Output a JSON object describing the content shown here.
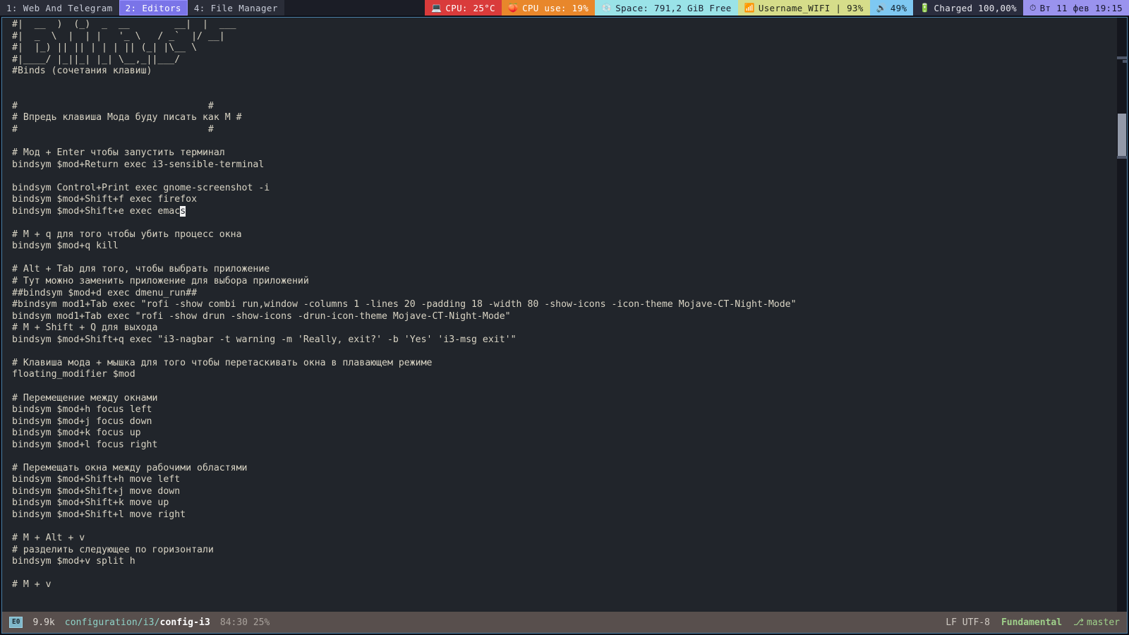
{
  "i3bar": {
    "workspaces": [
      {
        "label": "1: Web And Telegram",
        "focused": false
      },
      {
        "label": "2: Editors",
        "focused": true
      },
      {
        "label": "4: File Manager",
        "focused": false
      }
    ],
    "blocks": [
      {
        "name": "cpu-temp",
        "icon": "laptop-icon",
        "glyph": "💻",
        "text": "CPU: 25°C"
      },
      {
        "name": "cpu-usage",
        "icon": "chip-icon",
        "glyph": "🍑",
        "text": "CPU use: 19%"
      },
      {
        "name": "disk-space",
        "icon": "disk-icon",
        "glyph": "💿",
        "text": "Space: 791,2 GiB Free"
      },
      {
        "name": "wifi",
        "icon": "wifi-icon",
        "glyph": "📶",
        "text": "Username_WIFI | 93%"
      },
      {
        "name": "volume",
        "icon": "speaker-icon",
        "glyph": "🔊",
        "text": "49%"
      },
      {
        "name": "battery",
        "icon": "battery-icon",
        "glyph": "🔋",
        "text": "Charged 100,00%"
      },
      {
        "name": "clock",
        "icon": "clock-icon",
        "glyph": "⏱",
        "text": "Вт 11 фев 19:15"
      }
    ]
  },
  "editor": {
    "code": "#|  __  )  (_)  _  __        __|  |  ___\n#|  _  \\  |  | |   '_ \\   / _`  |/ __|\n#|  |_) || || | | | || (_| |\\__ \\\n#|____/ |_||_| |_| \\__,_||___/\n#Binds (сочетания клавиш)\n\n\n#                                  #\n# Впредь клавиша Мода буду писать как М #\n#                                  #\n\n# Мод + Enter чтобы запустить терминал\nbindsym $mod+Return exec i3-sensible-terminal\n\nbindsym Control+Print exec gnome-screenshot -i\nbindsym $mod+Shift+f exec firefox\nbindsym $mod+Shift+e exec emac§s§\n\n# M + q для того чтобы убить процесс окна\nbindsym $mod+q kill\n\n# Alt + Tab для того, чтобы выбрать приложение\n# Тут можно заменить приложение для выбора приложений\n##bindsym $mod+d exec dmenu_run##\n#bindsym mod1+Tab exec \"rofi -show combi run,window -columns 1 -lines 20 -padding 18 -width 80 -show-icons -icon-theme Mojave-CT-Night-Mode\"\nbindsym mod1+Tab exec \"rofi -show drun -show-icons -drun-icon-theme Mojave-CT-Night-Mode\"\n# M + Shift + Q для выхода\nbindsym $mod+Shift+q exec \"i3-nagbar -t warning -m 'Really, exit?' -b 'Yes' 'i3-msg exit'\"\n\n# Клавиша мода + мышка для того чтобы перетаскивать окна в плавающем режиме\nfloating_modifier $mod\n\n# Перемещение между окнами\nbindsym $mod+h focus left\nbindsym $mod+j focus down\nbindsym $mod+k focus up\nbindsym $mod+l focus right\n\n# Перемещать окна между рабочими областями\nbindsym $mod+Shift+h move left\nbindsym $mod+Shift+j move down\nbindsym $mod+Shift+k move up\nbindsym $mod+Shift+l move right\n\n# M + Alt + v\n# разделить следующее по горизонтали\nbindsym $mod+v split h\n\n# M + v"
  },
  "modeline": {
    "encoding_badge": "E0",
    "file_size": "9.9k",
    "path_dir": "configuration/i3/",
    "path_file": "config-i3",
    "position": "84:30 25%",
    "line_ending": "LF UTF-8",
    "major_mode": "Fundamental",
    "vc_icon": "branch-icon",
    "vc_glyph": "⎇",
    "vc_branch": "master"
  }
}
